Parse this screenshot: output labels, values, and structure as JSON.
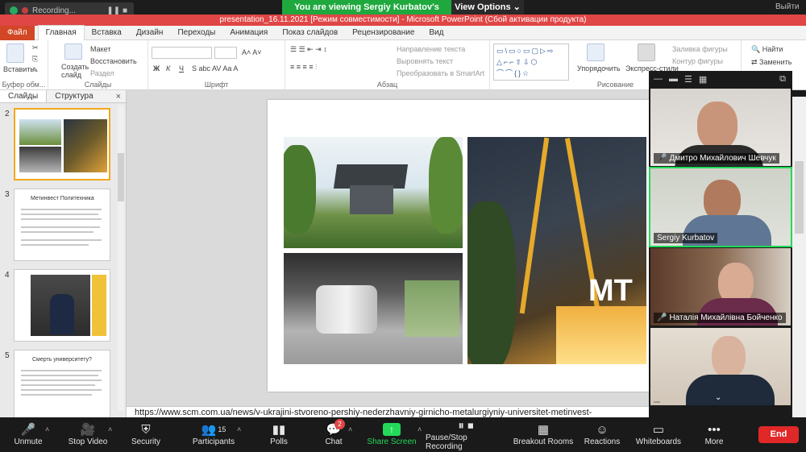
{
  "zoom_top": {
    "recording_label": "Recording...",
    "viewing_banner": "You are viewing Sergiy Kurbatov's screen",
    "view_options": "View Options",
    "exit_label": "Выйти"
  },
  "ppt": {
    "title": "presentation_16.11.2021 [Режим совместимости] - Microsoft PowerPoint (Сбой активации продукта)",
    "tabs": [
      "Файл",
      "Главная",
      "Вставка",
      "Дизайн",
      "Переходы",
      "Анимация",
      "Показ слайдов",
      "Рецензирование",
      "Вид"
    ],
    "active_tab": "Главная",
    "ribbon": {
      "paste_label": "Вставить",
      "clipboard_group": "Буфер обм...",
      "new_slide_label": "Создать слайд",
      "layout_label": "Макет",
      "restore_label": "Восстановить",
      "section_label": "Раздел",
      "slides_group": "Слайды",
      "font_group": "Шрифт",
      "text_direction": "Направление текста",
      "align_text": "Выровнять текст",
      "convert_smartart": "Преобразовать в SmartArt",
      "paragraph_group": "Абзац",
      "arrange_label": "Упорядочить",
      "quick_styles_label": "Экспресс-стили",
      "shape_fill": "Заливка фигуры",
      "shape_outline": "Контур фигуры",
      "drawing_group": "Рисование",
      "find_label": "Найти",
      "replace_label": "Заменить"
    },
    "pane": {
      "tab_slides": "Слайды",
      "tab_outline": "Структура",
      "close": "×",
      "thumbs": [
        {
          "num": "2",
          "title": ""
        },
        {
          "num": "3",
          "title": "Метинвест Политехника"
        },
        {
          "num": "4",
          "title": ""
        },
        {
          "num": "5",
          "title": "Смерть университету?"
        }
      ]
    },
    "notes_text": "https://www.scm.com.ua/news/v-ukrajini-stvoreno-pershiy-nederzhavniy-girnicho-metalurgiyniy-universitet-metinvest-",
    "slide": {
      "building_sign": "MT"
    }
  },
  "video": {
    "participants": [
      {
        "name": "Дмитро Михайлович Шевчук",
        "muted": true
      },
      {
        "name": "Sergiy Kurbatov",
        "muted": false
      },
      {
        "name": "Наталія Михайлівна Бойченко",
        "muted": true
      },
      {
        "name": "",
        "muted": false
      }
    ]
  },
  "toolbar": {
    "unmute": "Unmute",
    "stop_video": "Stop Video",
    "security": "Security",
    "participants": "Participants",
    "participants_count": "15",
    "polls": "Polls",
    "chat": "Chat",
    "chat_badge": "2",
    "share_screen": "Share Screen",
    "pause_recording": "Pause/Stop Recording",
    "breakout": "Breakout Rooms",
    "reactions": "Reactions",
    "whiteboards": "Whiteboards",
    "more": "More",
    "end": "End"
  },
  "colors": {
    "accent_green": "#23d959",
    "banner_green": "#1fa83e",
    "ppt_red": "#d24726",
    "end_red": "#e02828"
  }
}
